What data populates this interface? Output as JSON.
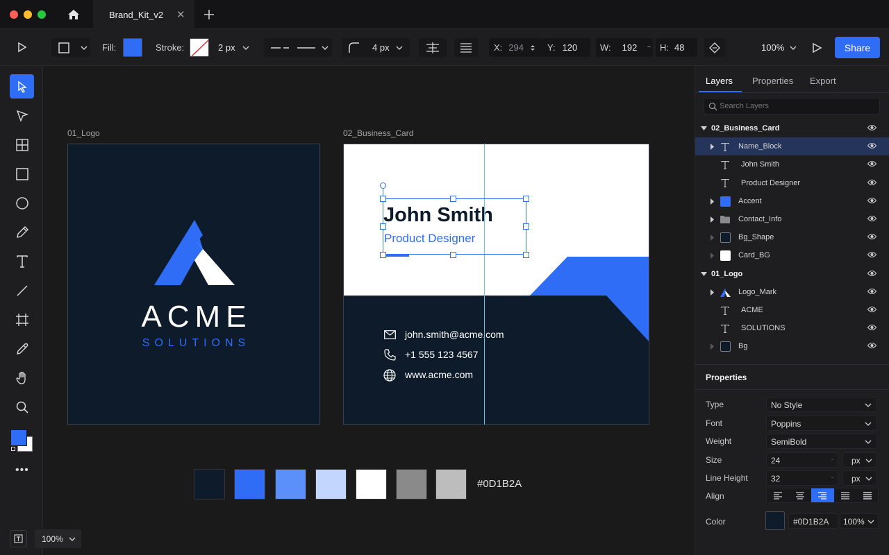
{
  "app": {
    "tab_title": "Brand_Kit_v2"
  },
  "colors": {
    "accent": "#2f6df6",
    "navy": "#0d1b2a",
    "panel": "#1e1e20",
    "selected_row": "#24345a"
  },
  "toolbar": {
    "fill_label": "Fill:",
    "stroke_label": "Stroke:",
    "stroke_width": "2 px",
    "corner_radius": "4 px",
    "x_label": "X:",
    "x_value": "294",
    "y_label": "Y:",
    "y_value": "120",
    "w_label": "W:",
    "w_value": "192",
    "h_label": "H:",
    "h_value": "48",
    "zoom": "100%",
    "share_label": "Share"
  },
  "artboards": {
    "logo": {
      "name": "01_Logo",
      "company": "ACME",
      "tagline": "SOLUTIONS"
    },
    "card": {
      "name": "02_Business_Card",
      "person_name": "John Smith",
      "person_title": "Product Designer",
      "email": "john.smith@acme.com",
      "phone": "+1 555 123 4567",
      "website": "www.acme.com"
    }
  },
  "palette": {
    "swatches": [
      "#0d1b2a",
      "#2f6df6",
      "#5b8ff9",
      "#c3d6fd",
      "#ffffff",
      "#8a8a8a",
      "#bdbdbd"
    ],
    "selected_hex": "#0D1B2A"
  },
  "bottom": {
    "zoom": "100%"
  },
  "panel": {
    "tabs": [
      "Layers",
      "Properties",
      "Export"
    ],
    "search_placeholder": "Search Layers",
    "layers": [
      {
        "label": "02_Business_Card",
        "icon": "group",
        "level": 0
      },
      {
        "label": "Name_Block",
        "icon": "text",
        "level": 1
      },
      {
        "label": "John Smith",
        "icon": "text",
        "level": 1
      },
      {
        "label": "Product Designer",
        "icon": "text",
        "level": 1
      },
      {
        "label": "Accent",
        "icon": "blue-square",
        "level": 1
      },
      {
        "label": "Contact_Info",
        "icon": "folder",
        "level": 1
      },
      {
        "label": "Bg_Shape",
        "icon": "navy-square",
        "level": 1
      },
      {
        "label": "Card_BG",
        "icon": "white-square",
        "level": 1
      },
      {
        "label": "01_Logo",
        "icon": "group",
        "level": 0
      },
      {
        "label": "Logo_Mark",
        "icon": "logo",
        "level": 1
      },
      {
        "label": "ACME",
        "icon": "text",
        "level": 1
      },
      {
        "label": "SOLUTIONS",
        "icon": "text",
        "level": 1
      },
      {
        "label": "Bg",
        "icon": "navy-square",
        "level": 1
      }
    ],
    "properties": {
      "heading": "Properties",
      "type_label": "Type",
      "type_value": "No Style",
      "font_label": "Font",
      "font_value": "Poppins",
      "weight_label": "Weight",
      "weight_value": "SemiBold",
      "size_label": "Size",
      "size_value": "24",
      "size_unit": "px",
      "lh_label": "Line Height",
      "lh_value": "32",
      "lh_unit": "px",
      "align_label": "Align",
      "color_label": "Color",
      "color_value": "#0D1B2A",
      "opacity": "100%"
    }
  }
}
